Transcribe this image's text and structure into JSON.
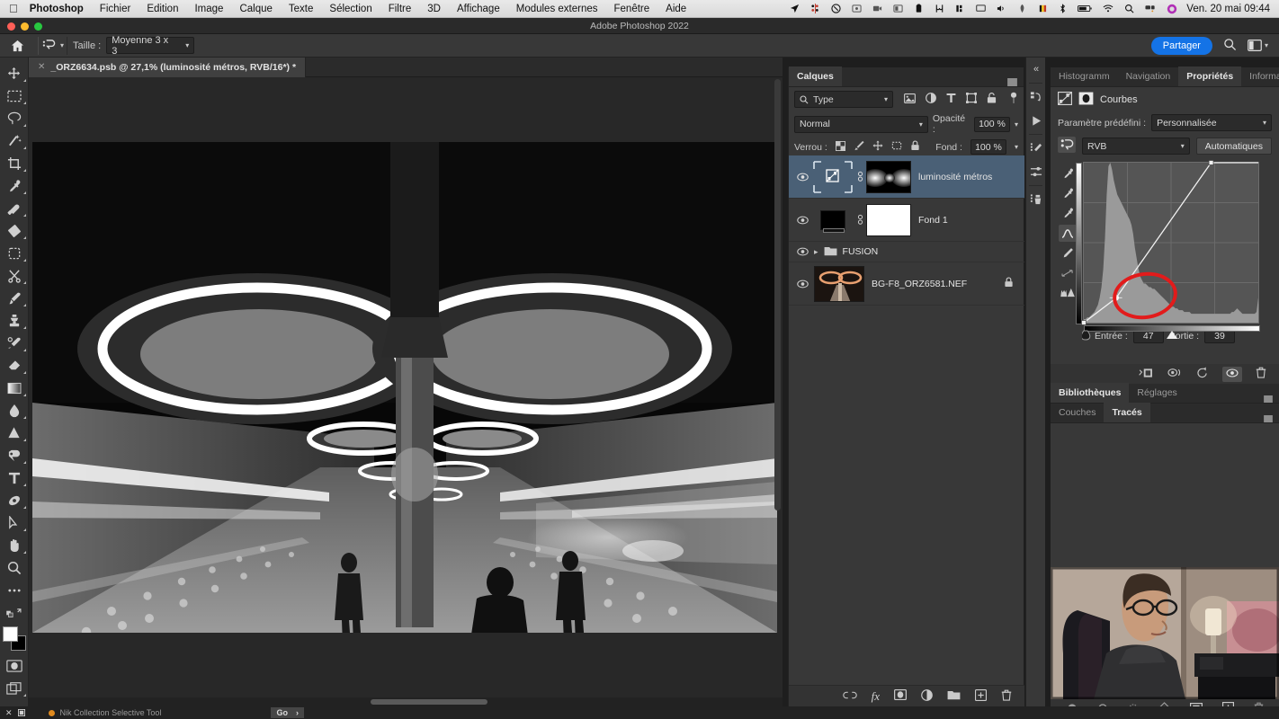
{
  "macbar": {
    "apple_icon": "apple-logo",
    "menus": [
      "Photoshop",
      "Fichier",
      "Edition",
      "Image",
      "Calque",
      "Texte",
      "Sélection",
      "Filtre",
      "3D",
      "Affichage",
      "Modules externes",
      "Fenêtre",
      "Aide"
    ],
    "status_icons": [
      "location-arrow-icon",
      "dropbox-icon",
      "do-not-disturb-icon",
      "screenshot-icon",
      "video-record-icon",
      "display-mirror-icon",
      "clipboard-icon",
      "search-spotlight-icon",
      "stats-icon",
      "airplay-icon",
      "volume-icon",
      "vpn-icon",
      "flag-icon",
      "bluetooth-icon",
      "battery-icon",
      "wifi-icon",
      "spotlight-icon",
      "control-center-icon",
      "siri-icon"
    ],
    "clock": "Ven. 20 mai  09:44"
  },
  "window": {
    "title": "Adobe Photoshop 2022"
  },
  "options_bar": {
    "home_icon": "home-icon",
    "tool_icon": "eyedropper-tool-icon",
    "size_label": "Taille :",
    "size_value": "Moyenne 3 x 3",
    "share_label": "Partager",
    "search_icon": "search-icon",
    "workspace_icon": "workspace-icon"
  },
  "toolbox": {
    "tools": [
      {
        "name": "move-tool",
        "icon": "move"
      },
      {
        "name": "rectangular-marquee-tool",
        "icon": "marquee"
      },
      {
        "name": "lasso-tool",
        "icon": "lasso"
      },
      {
        "name": "magic-wand-tool",
        "icon": "wand"
      },
      {
        "name": "crop-tool",
        "icon": "crop"
      },
      {
        "name": "eyedropper-tool",
        "icon": "eyedropper"
      },
      {
        "name": "spot-healing-brush-tool",
        "icon": "healing"
      },
      {
        "name": "patch-tool",
        "icon": "patch"
      },
      {
        "name": "object-selection-tool",
        "icon": "objsel"
      },
      {
        "name": "scissors-tool",
        "icon": "scissors"
      },
      {
        "name": "brush-tool",
        "icon": "brush"
      },
      {
        "name": "clone-stamp-tool",
        "icon": "stamp"
      },
      {
        "name": "history-brush-tool",
        "icon": "historybrush"
      },
      {
        "name": "eraser-tool",
        "icon": "eraser"
      },
      {
        "name": "gradient-tool",
        "icon": "gradient"
      },
      {
        "name": "blur-tool",
        "icon": "blur"
      },
      {
        "name": "dodge-tool",
        "icon": "dodge"
      },
      {
        "name": "pen-tool",
        "icon": "pen"
      },
      {
        "name": "type-tool",
        "icon": "type"
      },
      {
        "name": "path-selection-tool",
        "icon": "pathsel"
      },
      {
        "name": "direct-selection-tool",
        "icon": "arrow"
      },
      {
        "name": "hand-tool",
        "icon": "hand"
      },
      {
        "name": "zoom-tool",
        "icon": "zoom"
      },
      {
        "name": "edit-toolbar-tool",
        "icon": "dots"
      }
    ],
    "foreground_color": "#ffffff",
    "background_color": "#000000",
    "quickmask_icon": "quick-mask-icon",
    "screenmode_icon": "screen-mode-icon"
  },
  "document": {
    "tab_title": "_ORZ6634.psb @ 27,1% (luminosité métros, RVB/16*) *",
    "close_icon": "close-icon"
  },
  "layers_panel": {
    "tab_label": "Calques",
    "menu_icon": "panel-menu-icon",
    "filter_label": "Type",
    "filter_icons": [
      "image-filter-icon",
      "adjustment-filter-icon",
      "type-filter-icon",
      "shape-filter-icon",
      "smartobject-filter-icon"
    ],
    "filter_toggle_icon": "filter-power-icon",
    "blend_mode": "Normal",
    "opacity_label": "Opacité :",
    "opacity_value": "100 %",
    "lock_label": "Verrou :",
    "lock_icons": [
      "lock-transparency-icon",
      "lock-image-icon",
      "lock-position-icon",
      "lock-artboard-icon",
      "lock-all-icon"
    ],
    "fill_label": "Fond :",
    "fill_value": "100 %",
    "layers": [
      {
        "name": "luminosité métros",
        "selected": true,
        "visible": true,
        "kind": "adjustment",
        "locked": false
      },
      {
        "name": "Fond 1",
        "selected": false,
        "visible": true,
        "kind": "solid",
        "locked": false
      },
      {
        "name": "FUSION",
        "selected": false,
        "visible": true,
        "kind": "group",
        "locked": false
      },
      {
        "name": "BG-F8_ORZ6581.NEF",
        "selected": false,
        "visible": true,
        "kind": "image",
        "locked": true
      }
    ],
    "bottom_icons": [
      "link-layers-icon",
      "layer-fx-icon",
      "layer-mask-icon",
      "new-adjustment-icon",
      "new-group-icon",
      "new-layer-icon",
      "delete-layer-icon"
    ]
  },
  "properties_panel": {
    "tabs": [
      "Histogramm",
      "Navigation",
      "Propriétés",
      "Informations"
    ],
    "active_tab": "Propriétés",
    "menu_icon": "panel-menu-icon",
    "adjustment_title": "Courbes",
    "adjustment_icon": "curves-icon",
    "mask_icon": "mask-icon",
    "preset_label": "Paramètre prédéfini :",
    "preset_value": "Personnalisée",
    "channel_value": "RVB",
    "auto_label": "Automatiques",
    "on_image_icon": "on-image-adjust-icon",
    "curve_tools": [
      "black-point-eyedropper-icon",
      "gray-point-eyedropper-icon",
      "white-point-eyedropper-icon",
      "curve-point-tool-icon",
      "pencil-curve-tool-icon",
      "smooth-curve-icon",
      "clip-warning-icon"
    ],
    "input_label": "Entrée :",
    "input_value": "47",
    "output_label": "Sortie :",
    "output_value": "39",
    "bottom_icons": [
      "clip-to-layer-icon",
      "view-previous-state-icon",
      "reset-icon",
      "toggle-visibility-icon",
      "delete-adjustment-icon"
    ],
    "annotation": {
      "shape": "red-ellipse",
      "color": "#e21b1b"
    }
  },
  "libraries_panel": {
    "tabs": [
      "Bibliothèques",
      "Réglages"
    ],
    "active_tab": "Bibliothèques",
    "menu_icon": "panel-menu-icon"
  },
  "channels_panel": {
    "tabs": [
      "Couches",
      "Tracés"
    ],
    "active_tab": "Tracés",
    "menu_icon": "panel-menu-icon"
  },
  "right_strip_icons": [
    "collapse-icon",
    "history-icon",
    "play-icon",
    "brush-settings-icon",
    "tool-presets-icon",
    "clone-source-icon"
  ],
  "left_strip_icons": [
    "collapse-panels-icon",
    "adjustments-icon",
    "styles-icon",
    "channels-icon",
    "paths-icon"
  ],
  "mask_panel_bottom_icons": [
    "select-subject-icon",
    "mask-circle-icon",
    "mask-dotted-icon",
    "mask-diamond-icon",
    "mask-solid-icon",
    "mask-add-icon",
    "mask-delete-icon"
  ],
  "status_bar": {
    "left_icons": [
      "close-small-icon",
      "panel-small-icon"
    ],
    "plugin_name": "Nik Collection Selective Tool",
    "go_label": "Go",
    "go_arrow": "chevron-right-icon"
  },
  "chart_data": {
    "type": "line",
    "title": "Courbes RVB",
    "xlabel": "Entrée",
    "ylabel": "Sortie",
    "xlim": [
      0,
      255
    ],
    "ylim": [
      0,
      255
    ],
    "grid": true,
    "series": [
      {
        "name": "RVB curve",
        "points": [
          [
            0,
            0
          ],
          [
            47,
            39
          ],
          [
            186,
            255
          ],
          [
            255,
            255
          ]
        ]
      }
    ],
    "control_points": [
      {
        "input": 0,
        "output": 0
      },
      {
        "input": 47,
        "output": 39
      },
      {
        "input": 186,
        "output": 255
      }
    ],
    "selected_point": {
      "input": 47,
      "output": 39
    },
    "histogram_note": "Luminosity histogram with a tall narrow peak in the shadows around 20-28% and a long low tail toward the highlights",
    "histogram": [
      2,
      2,
      3,
      3,
      4,
      5,
      6,
      8,
      10,
      14,
      20,
      30,
      48,
      72,
      88,
      90,
      86,
      80,
      76,
      72,
      70,
      68,
      66,
      64,
      62,
      60,
      58,
      55,
      50,
      42,
      36,
      30,
      26,
      24,
      22,
      22,
      21,
      20,
      20,
      19,
      19,
      18,
      17,
      16,
      15,
      14,
      13,
      12,
      11,
      10,
      9,
      9,
      8,
      8,
      7,
      7,
      7,
      6,
      6,
      6,
      6,
      5,
      5,
      5,
      5,
      5,
      5,
      5,
      5,
      5,
      5,
      5,
      5,
      5,
      5,
      5,
      5,
      5,
      5,
      5,
      5,
      5,
      5,
      5,
      6,
      6,
      7,
      8,
      7,
      6,
      5,
      5,
      5,
      5,
      5,
      5,
      5,
      5,
      6,
      14
    ]
  }
}
